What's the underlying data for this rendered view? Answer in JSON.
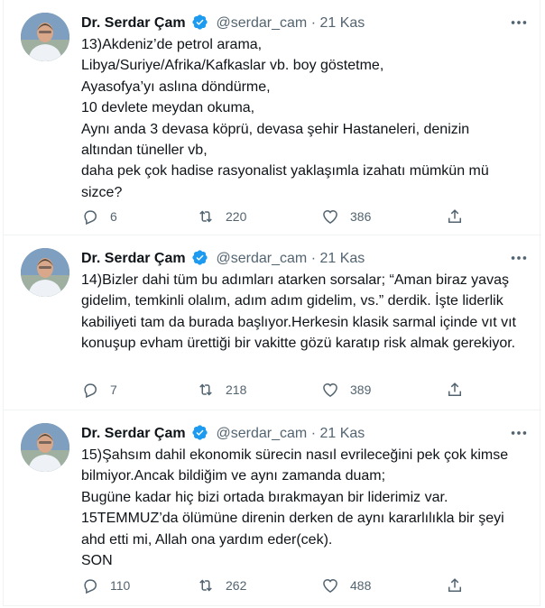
{
  "tweets": [
    {
      "name": "Dr. Serdar Çam",
      "handle": "@serdar_cam",
      "separator": "·",
      "date": "21 Kas",
      "text": "13)Akdeniz’de petrol arama,\nLibya/Suriye/Afrika/Kafkaslar vb. boy göstetme,\nAyasofya’yı aslına döndürme,\n10 devlete meydan okuma,\nAynı anda 3 devasa köprü, devasa şehir Hastaneleri, denizin altından tüneller vb,\ndaha pek çok hadise rasyonalist yaklaşımla izahatı mümkün mü sizce?",
      "replies": "6",
      "retweets": "220",
      "likes": "386"
    },
    {
      "name": "Dr. Serdar Çam",
      "handle": "@serdar_cam",
      "separator": "·",
      "date": "21 Kas",
      "text": "14)Bizler dahi tüm bu adımları atarken sorsalar; “Aman biraz yavaş gidelim, temkinli olalım, adım adım gidelim, vs.” derdik. İşte liderlik kabiliyeti tam da burada başlıyor.Herkesin klasik sarmal içinde vıt vıt konuşup evham ürettiği bir vakitte gözü karatıp risk almak gerekiyor.",
      "replies": "7",
      "retweets": "218",
      "likes": "389"
    },
    {
      "name": "Dr. Serdar Çam",
      "handle": "@serdar_cam",
      "separator": "·",
      "date": "21 Kas",
      "text": "15)Şahsım dahil ekonomik sürecin nasıl evrileceğini pek çok kimse bilmiyor.Ancak bildiğim ve aynı zamanda duam;\nBugüne kadar hiç bizi ortada bırakmayan bir liderimiz var.\n15TEMMUZ’da ölümüne direnin derken de aynı kararlılıkla bir şeyi ahd etti mi, Allah ona yardım eder(cek).\nSON",
      "replies": "110",
      "retweets": "262",
      "likes": "488"
    }
  ],
  "icons": {
    "verified": "verified-badge-icon",
    "more": "more-horizontal-icon",
    "reply": "reply-icon",
    "retweet": "retweet-icon",
    "like": "heart-icon",
    "share": "share-icon"
  },
  "colors": {
    "text": "#0f1419",
    "muted": "#536471",
    "verified": "#1d9bf0",
    "divider": "#eff3f4"
  }
}
